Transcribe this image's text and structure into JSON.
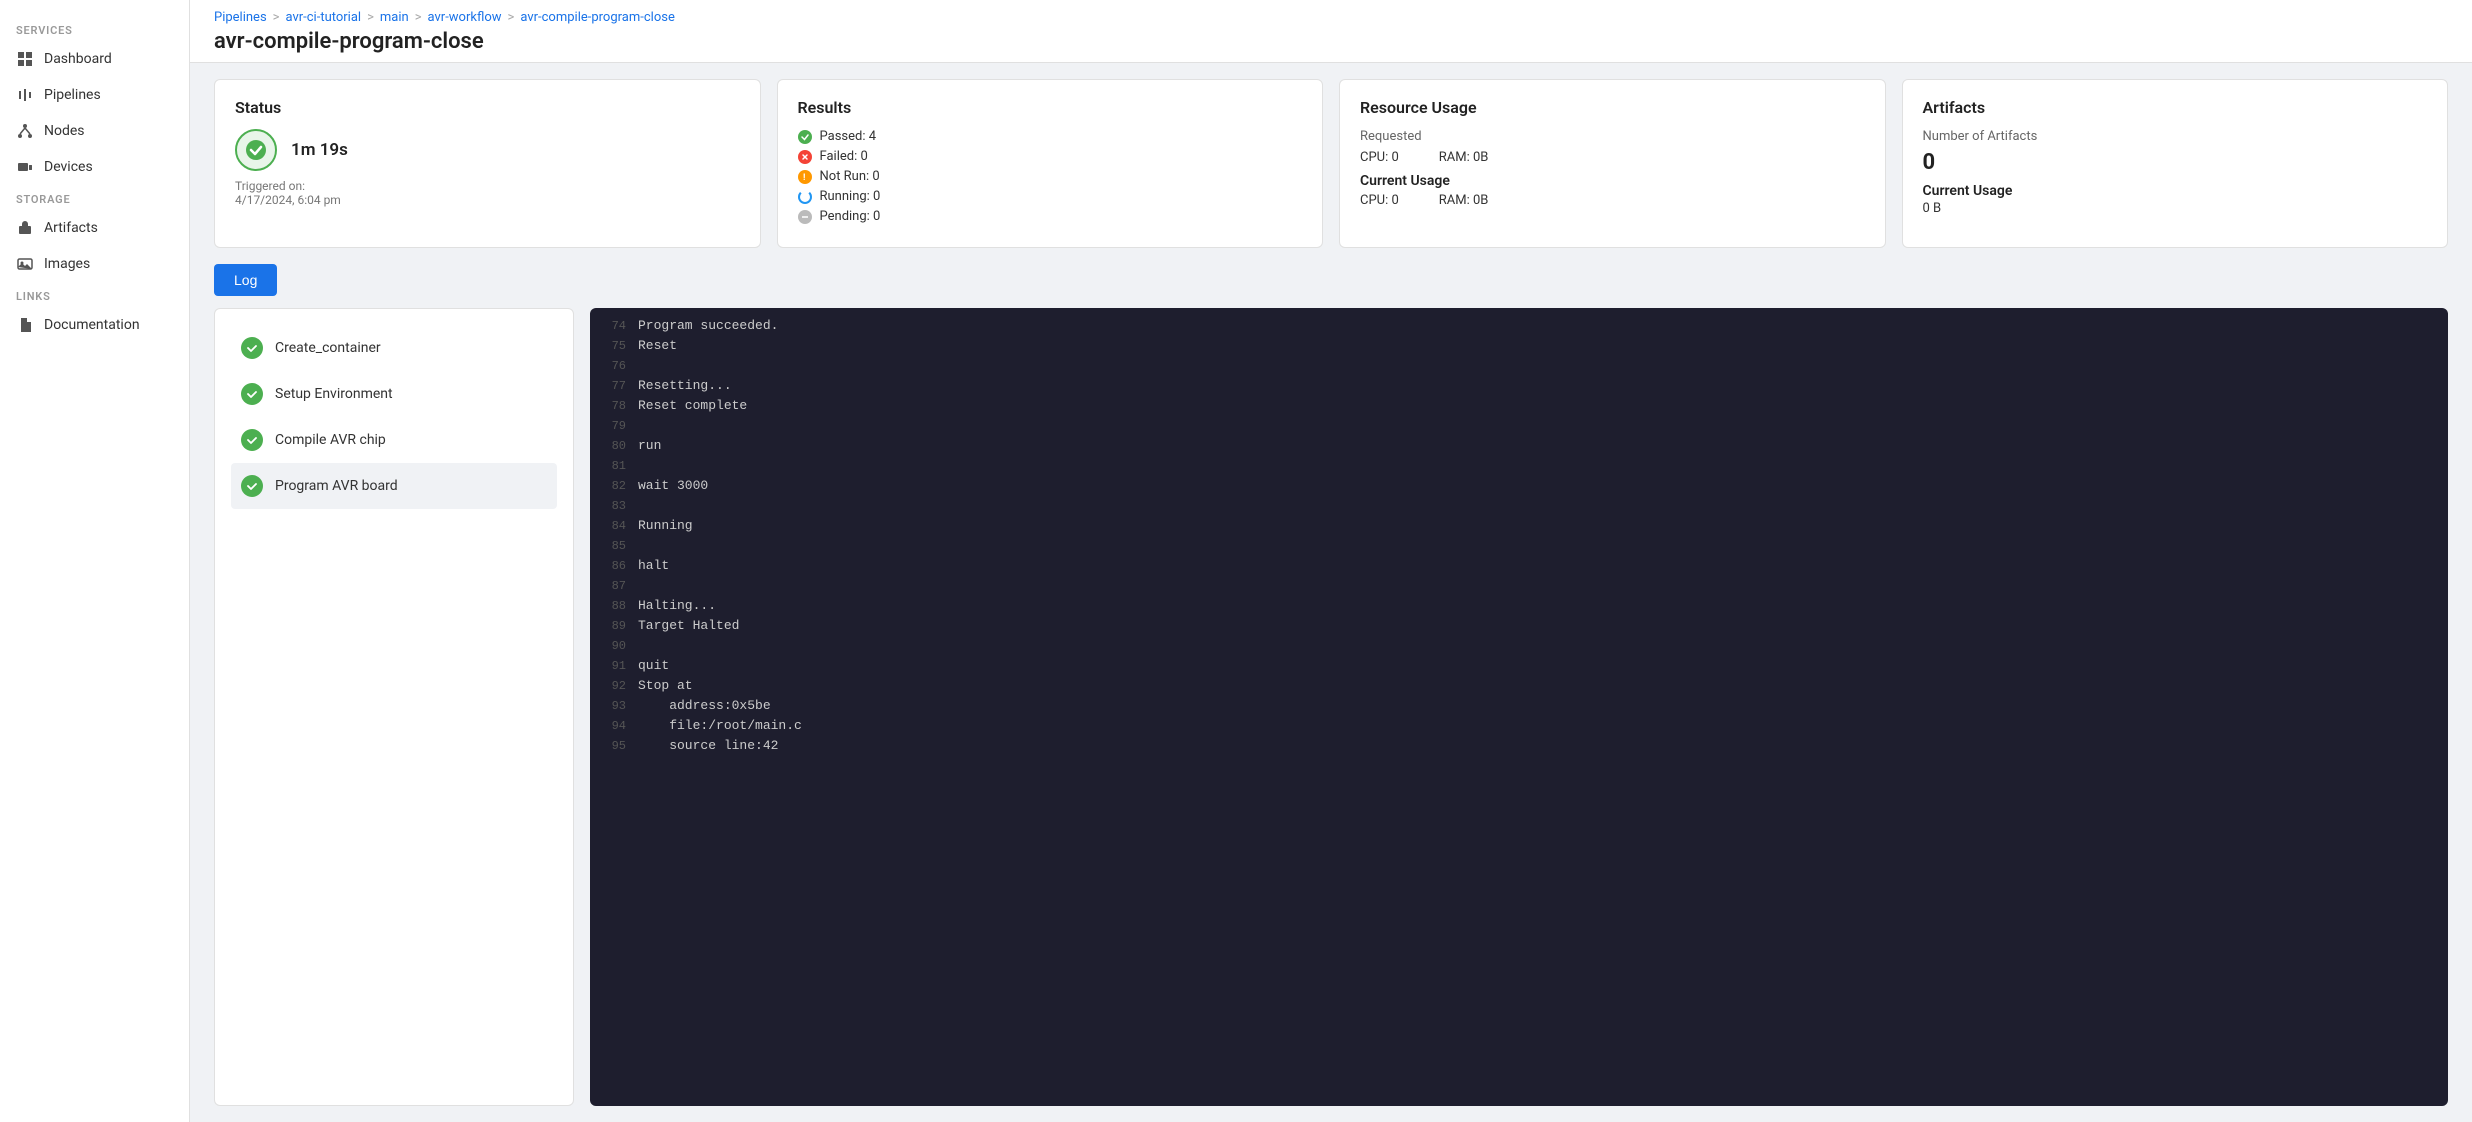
{
  "sidebar": {
    "services_label": "SERVICES",
    "storage_label": "STORAGE",
    "links_label": "LINKS",
    "items": [
      {
        "id": "dashboard",
        "label": "Dashboard",
        "icon": "grid"
      },
      {
        "id": "pipelines",
        "label": "Pipelines",
        "icon": "pipeline"
      },
      {
        "id": "nodes",
        "label": "Nodes",
        "icon": "nodes"
      },
      {
        "id": "devices",
        "label": "Devices",
        "icon": "devices"
      },
      {
        "id": "artifacts",
        "label": "Artifacts",
        "icon": "artifacts"
      },
      {
        "id": "images",
        "label": "Images",
        "icon": "images"
      },
      {
        "id": "documentation",
        "label": "Documentation",
        "icon": "doc"
      }
    ]
  },
  "breadcrumb": {
    "items": [
      {
        "label": "Pipelines",
        "link": true
      },
      {
        "label": "avr-ci-tutorial",
        "link": true
      },
      {
        "label": "main",
        "link": true
      },
      {
        "label": "avr-workflow",
        "link": true
      },
      {
        "label": "avr-compile-program-close",
        "link": true
      }
    ]
  },
  "page_title": "avr-compile-program-close",
  "cards": {
    "status": {
      "title": "Status",
      "time": "1m 19s",
      "triggered_label": "Triggered on:",
      "triggered_date": "4/17/2024, 6:04 pm"
    },
    "results": {
      "title": "Results",
      "rows": [
        {
          "label": "Passed: 4",
          "type": "green"
        },
        {
          "label": "Failed: 0",
          "type": "red"
        },
        {
          "label": "Not Run: 0",
          "type": "yellow"
        },
        {
          "label": "Running: 0",
          "type": "blue"
        },
        {
          "label": "Pending: 0",
          "type": "gray"
        }
      ]
    },
    "resource": {
      "title": "Resource Usage",
      "requested_label": "Requested",
      "cpu_req": "CPU: 0",
      "ram_req": "RAM: 0B",
      "current_label": "Current Usage",
      "cpu_cur": "CPU: 0",
      "ram_cur": "RAM: 0B"
    },
    "artifacts": {
      "title": "Artifacts",
      "number_label": "Number of Artifacts",
      "number": "0",
      "current_label": "Current Usage",
      "current_val": "0 B"
    }
  },
  "log_button": "Log",
  "steps": [
    {
      "label": "Create_container",
      "active": false
    },
    {
      "label": "Setup Environment",
      "active": false
    },
    {
      "label": "Compile AVR chip",
      "active": false
    },
    {
      "label": "Program AVR board",
      "active": true
    }
  ],
  "log_lines": [
    {
      "num": 74,
      "text": "Program succeeded."
    },
    {
      "num": 75,
      "text": "Reset"
    },
    {
      "num": 76,
      "text": ""
    },
    {
      "num": 77,
      "text": "Resetting..."
    },
    {
      "num": 78,
      "text": "Reset complete"
    },
    {
      "num": 79,
      "text": ""
    },
    {
      "num": 80,
      "text": "run"
    },
    {
      "num": 81,
      "text": ""
    },
    {
      "num": 82,
      "text": "wait 3000"
    },
    {
      "num": 83,
      "text": ""
    },
    {
      "num": 84,
      "text": "Running"
    },
    {
      "num": 85,
      "text": ""
    },
    {
      "num": 86,
      "text": "halt"
    },
    {
      "num": 87,
      "text": ""
    },
    {
      "num": 88,
      "text": "Halting..."
    },
    {
      "num": 89,
      "text": "Target Halted"
    },
    {
      "num": 90,
      "text": ""
    },
    {
      "num": 91,
      "text": "quit"
    },
    {
      "num": 92,
      "text": "Stop at"
    },
    {
      "num": 93,
      "text": "    address:0x5be"
    },
    {
      "num": 94,
      "text": "    file:/root/main.c"
    },
    {
      "num": 95,
      "text": "    source line:42"
    }
  ]
}
